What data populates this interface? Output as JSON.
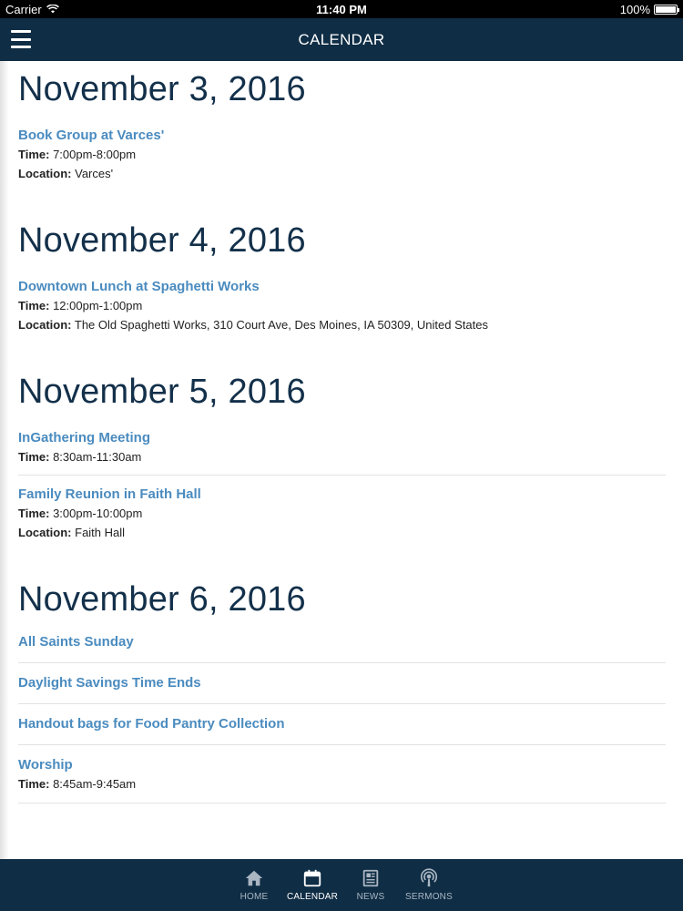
{
  "status_bar": {
    "carrier": "Carrier",
    "time": "11:40 PM",
    "battery": "100%"
  },
  "nav": {
    "title": "CALENDAR"
  },
  "days": [
    {
      "date": "November 3, 2016",
      "events": [
        {
          "title": "Book Group at Varces'",
          "time_label": "Time:",
          "time": "7:00pm-8:00pm",
          "location_label": "Location:",
          "location": "Varces'"
        }
      ]
    },
    {
      "date": "November 4, 2016",
      "events": [
        {
          "title": "Downtown Lunch at Spaghetti Works",
          "time_label": "Time:",
          "time": "12:00pm-1:00pm",
          "location_label": "Location:",
          "location": "The Old Spaghetti Works, 310 Court Ave, Des Moines, IA 50309, United States"
        }
      ]
    },
    {
      "date": "November 5, 2016",
      "events": [
        {
          "title": "InGathering Meeting",
          "time_label": "Time:",
          "time": "8:30am-11:30am"
        },
        {
          "title": "Family Reunion in Faith Hall",
          "time_label": "Time:",
          "time": "3:00pm-10:00pm",
          "location_label": "Location:",
          "location": "Faith Hall"
        }
      ]
    },
    {
      "date": "November 6, 2016",
      "events": [
        {
          "title": "All Saints Sunday"
        },
        {
          "title": "Daylight Savings Time Ends"
        },
        {
          "title": "Handout bags for Food Pantry Collection"
        },
        {
          "title": "Worship",
          "time_label": "Time:",
          "time": "8:45am-9:45am"
        }
      ]
    }
  ],
  "tabs": [
    {
      "label": "HOME",
      "icon": "home-icon",
      "active": false
    },
    {
      "label": "CALENDAR",
      "icon": "calendar-icon",
      "active": true
    },
    {
      "label": "NEWS",
      "icon": "news-icon",
      "active": false
    },
    {
      "label": "SERMONS",
      "icon": "podcast-icon",
      "active": false
    }
  ],
  "colors": {
    "nav_background": "#0f2d45",
    "heading": "#13304a",
    "link": "#4a8bbf"
  }
}
